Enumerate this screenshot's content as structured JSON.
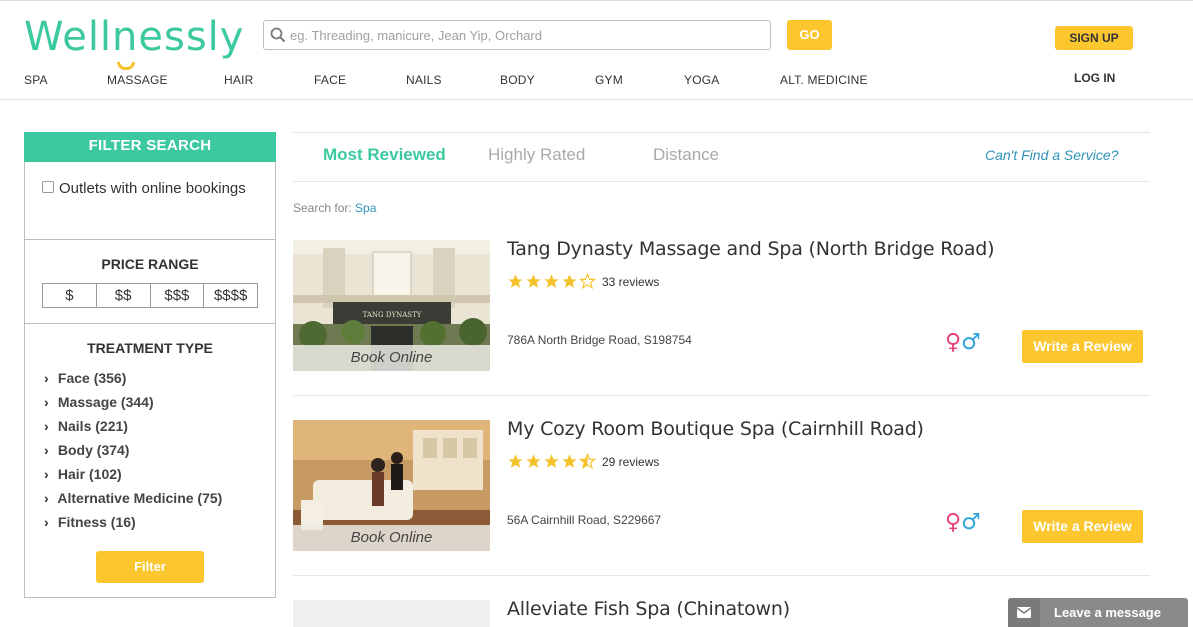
{
  "header": {
    "logo_text": "Wellnessly",
    "search": {
      "placeholder": "eg. Threading, manicure, Jean Yip, Orchard",
      "value": ""
    },
    "go_label": "GO",
    "signup_label": "SIGN UP",
    "login_label": "LOG IN",
    "nav": [
      "SPA",
      "MASSAGE",
      "HAIR",
      "FACE",
      "NAILS",
      "BODY",
      "GYM",
      "YOGA",
      "ALT. MEDICINE"
    ]
  },
  "sidebar": {
    "title": "FILTER SEARCH",
    "online_label": "Outlets with online bookings",
    "online_checked": false,
    "price_title": "PRICE RANGE",
    "price_options": [
      "$",
      "$$",
      "$$$",
      "$$$$"
    ],
    "treatment_title": "TREATMENT TYPE",
    "treatments": [
      "Face (356)",
      "Massage (344)",
      "Nails (221)",
      "Body (374)",
      "Hair (102)",
      "Alternative Medicine (75)",
      "Fitness (16)"
    ],
    "filter_label": "Filter"
  },
  "main": {
    "tabs": [
      {
        "label": "Most Reviewed",
        "active": true
      },
      {
        "label": "Highly Rated",
        "active": false
      },
      {
        "label": "Distance",
        "active": false
      }
    ],
    "cant_find": "Can't Find a Service?",
    "search_for_label": "Search for:",
    "search_for_term": "Spa",
    "listings": [
      {
        "title": "Tang Dynasty Massage and Spa (North Bridge Road)",
        "rating": 4,
        "reviews": "33 reviews",
        "address": "786A North Bridge Road, S198754",
        "book_label": "Book Online",
        "sign_text": "TANG DYNASTY",
        "review_button": "Write a Review",
        "gender": [
          "♀",
          "♂"
        ]
      },
      {
        "title": "My Cozy Room Boutique Spa (Cairnhill Road)",
        "rating": 4.5,
        "reviews": "29 reviews",
        "address": "56A Cairnhill Road, S229667",
        "book_label": "Book Online",
        "review_button": "Write a Review",
        "gender": [
          "♀",
          "♂"
        ]
      },
      {
        "title": "Alleviate Fish Spa (Chinatown)"
      }
    ]
  },
  "chat": {
    "label": "Leave a message"
  },
  "colors": {
    "brand": "#3cc9a0",
    "accent": "#fcc62e",
    "link": "#2f93b8",
    "female": "#e8407c",
    "male": "#2fa3d9"
  }
}
